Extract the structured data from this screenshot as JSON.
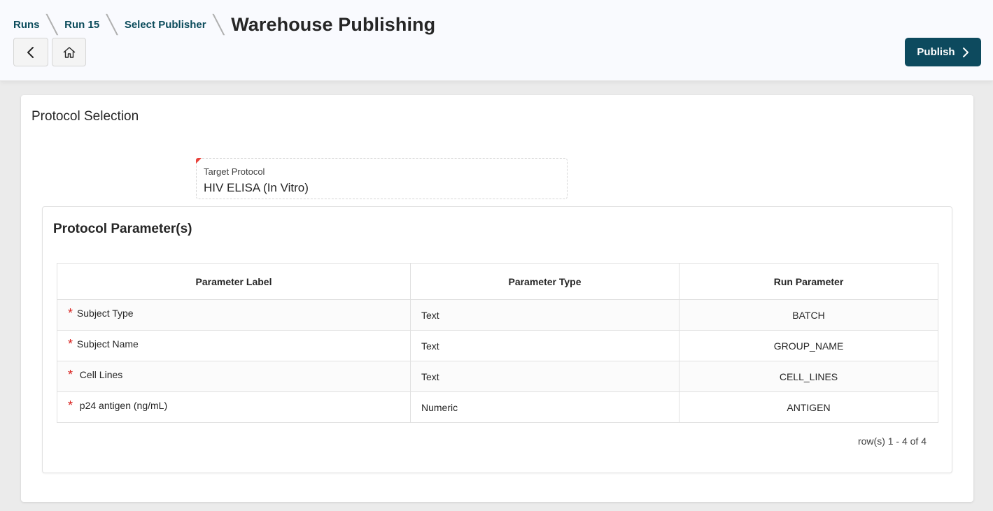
{
  "header": {
    "breadcrumbs": [
      "Runs",
      "Run 15",
      "Select Publisher"
    ],
    "page_title": "Warehouse Publishing",
    "publish_label": "Publish"
  },
  "icons": {
    "back": "chevron-left-icon",
    "home": "home-icon",
    "publish": "chevron-right-icon"
  },
  "colors": {
    "primary": "#0d4a5e",
    "breadcrumb": "#0c4c5c",
    "required": "#d8201c"
  },
  "main": {
    "card_title": "Protocol Selection",
    "target_protocol": {
      "label": "Target Protocol",
      "value": "HIV ELISA (In Vitro)"
    },
    "parameters": {
      "title": "Protocol Parameter(s)",
      "columns": [
        "Parameter Label",
        "Parameter Type",
        "Run Parameter"
      ],
      "required_marker": "*",
      "rows": [
        {
          "label": "Subject Type",
          "type": "Text",
          "run_param": "BATCH"
        },
        {
          "label": "Subject Name",
          "type": "Text",
          "run_param": "GROUP_NAME"
        },
        {
          "label": "Cell Lines",
          "type": "Text",
          "run_param": "CELL_LINES"
        },
        {
          "label": "p24 antigen (ng/mL)",
          "type": "Numeric",
          "run_param": "ANTIGEN"
        }
      ],
      "pagination": "row(s) 1 - 4 of 4"
    }
  }
}
